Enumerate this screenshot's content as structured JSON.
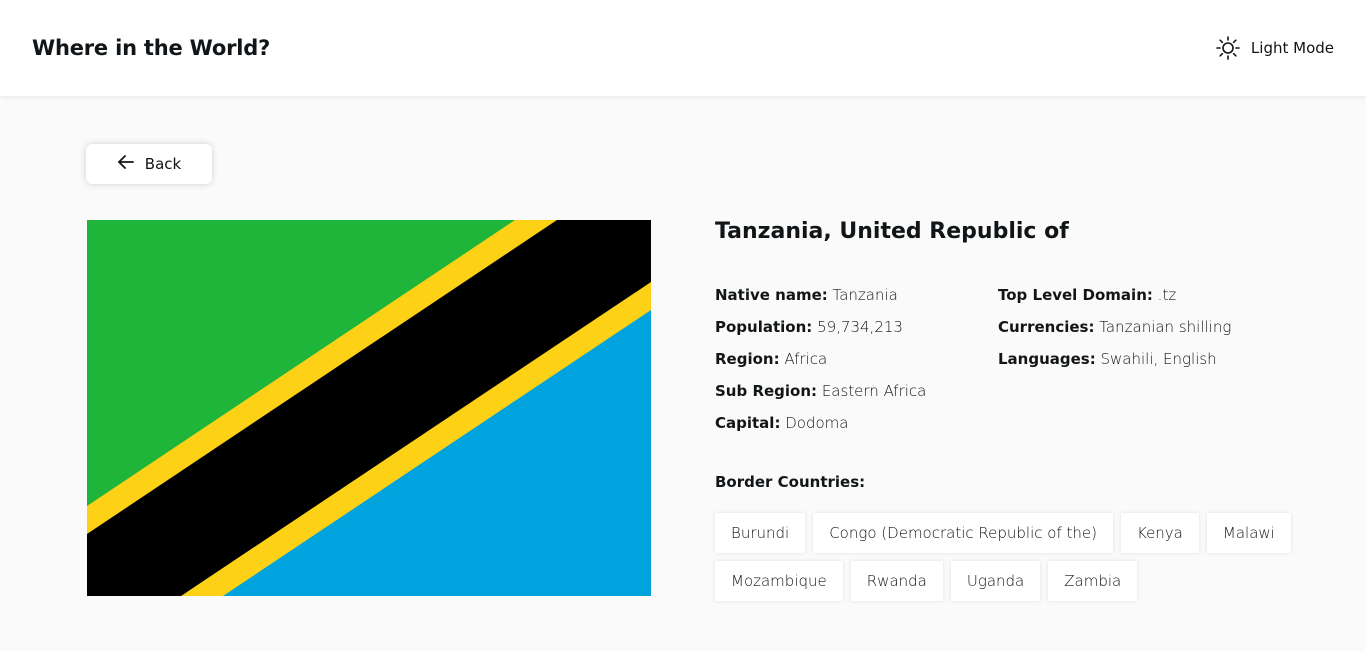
{
  "header": {
    "title": "Where in the World?",
    "mode_label": "Light Mode",
    "mode_icon": "sun-icon"
  },
  "back_button": {
    "label": "Back",
    "icon": "arrow-left-icon"
  },
  "country": {
    "name": "Tanzania, United Republic of",
    "flag_colors": {
      "green": "#1eb53a",
      "yellow": "#fcd116",
      "black": "#000000",
      "blue": "#00a3dd"
    },
    "left_details": [
      {
        "key": "Native name:",
        "value": "Tanzania"
      },
      {
        "key": "Population:",
        "value": "59,734,213"
      },
      {
        "key": "Region:",
        "value": "Africa"
      },
      {
        "key": "Sub Region:",
        "value": "Eastern Africa"
      },
      {
        "key": "Capital:",
        "value": "Dodoma"
      }
    ],
    "right_details": [
      {
        "key": "Top Level Domain:",
        "value": ".tz"
      },
      {
        "key": "Currencies:",
        "value": "Tanzanian shilling"
      },
      {
        "key": "Languages:",
        "value": "Swahili, English"
      }
    ],
    "border_label": "Border Countries:",
    "borders": [
      [
        "Burundi",
        "Congo (Democratic Republic of the)",
        "Kenya",
        "Malawi"
      ],
      [
        "Mozambique",
        "Rwanda",
        "Uganda",
        "Zambia"
      ]
    ]
  }
}
